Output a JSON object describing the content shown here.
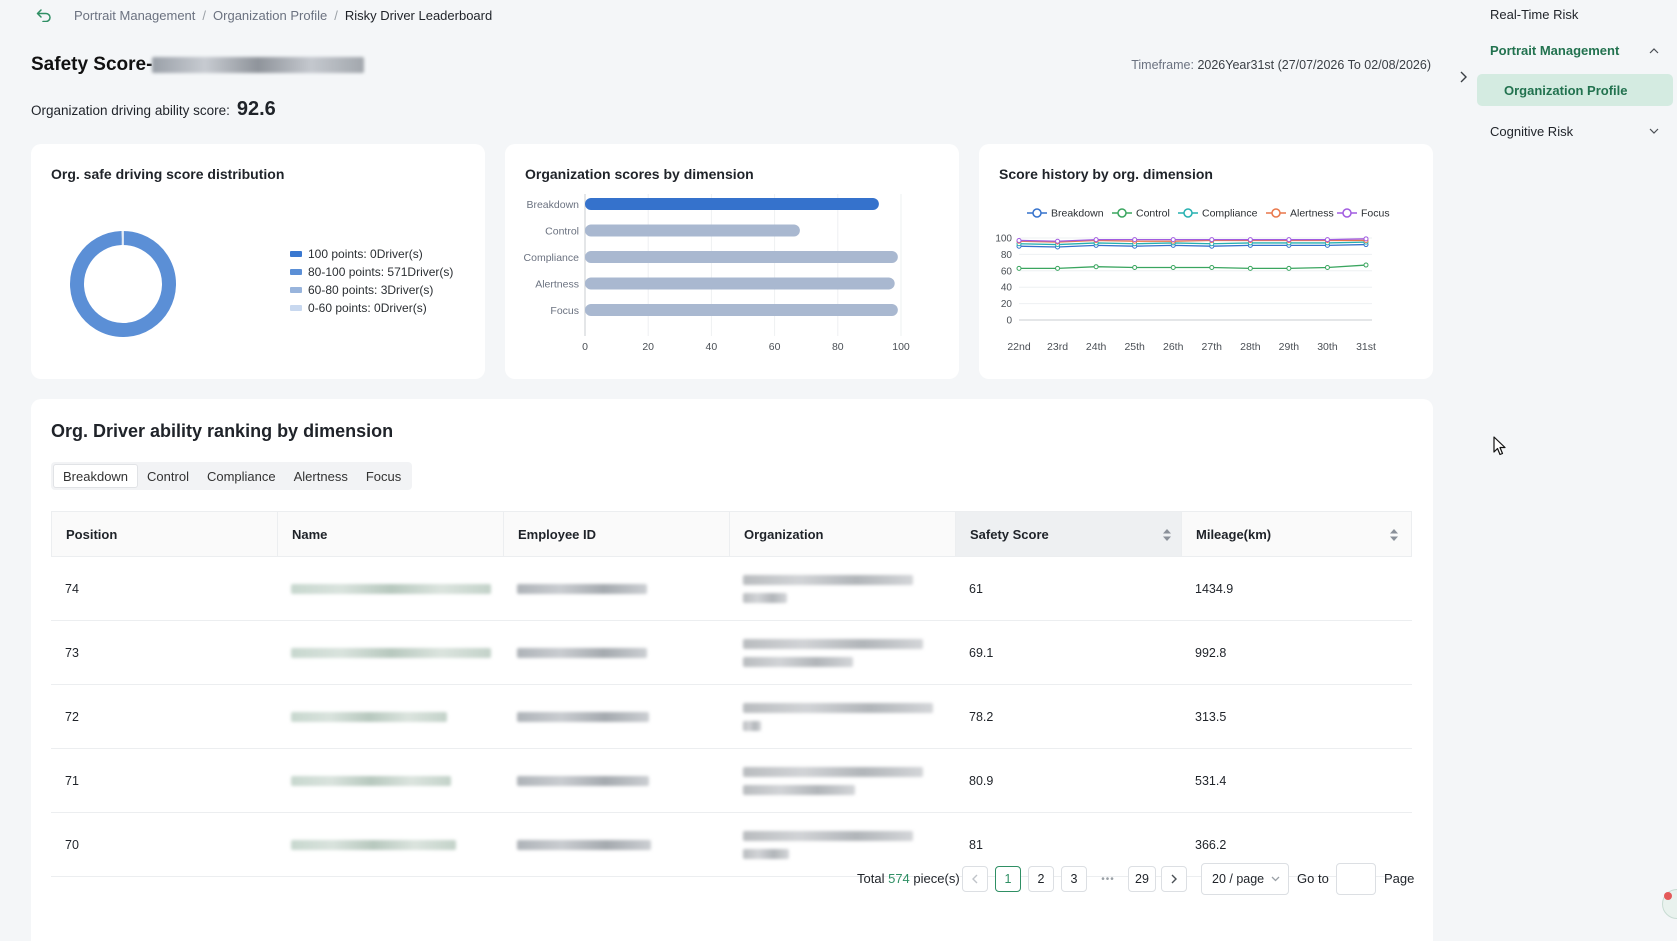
{
  "breadcrumb": {
    "items": [
      "Portrait Management",
      "Organization Profile"
    ],
    "current": "Risky Driver Leaderboard"
  },
  "header": {
    "title_prefix": "Safety Score-",
    "timeframe_label": "Timeframe:",
    "timeframe_value": "2026Year31st (27/07/2026 To 02/08/2026)",
    "ability_label": "Organization driving ability score:",
    "ability_value": "92.6"
  },
  "cards": {
    "distribution": {
      "title": "Org. safe driving score distribution",
      "legend": [
        {
          "label": "100 points:",
          "value": "0Driver(s)",
          "color": "#3a78d0"
        },
        {
          "label": "80-100 points:",
          "value": "571Driver(s)",
          "color": "#5b8fd6"
        },
        {
          "label": "60-80 points:",
          "value": "3Driver(s)",
          "color": "#98b4dc"
        },
        {
          "label": "0-60 points:",
          "value": "0Driver(s)",
          "color": "#c8d8ef"
        }
      ]
    },
    "by_dimension": {
      "title": "Organization scores by dimension"
    },
    "history": {
      "title": "Score history by org. dimension"
    }
  },
  "chart_data": [
    {
      "type": "pie",
      "categories": [
        "100 points",
        "80-100 points",
        "60-80 points",
        "0-60 points"
      ],
      "values": [
        0,
        571,
        3,
        0
      ]
    },
    {
      "type": "bar",
      "categories": [
        "Breakdown",
        "Control",
        "Compliance",
        "Alertness",
        "Focus"
      ],
      "values": [
        93,
        68,
        99,
        98,
        99
      ],
      "xlim": [
        0,
        100
      ],
      "xticks": [
        0,
        20,
        40,
        60,
        80,
        100
      ],
      "highlight_color": "#3572cc",
      "bar_color": "#a9b8d0"
    },
    {
      "type": "line",
      "x": [
        "22nd",
        "23rd",
        "24th",
        "25th",
        "26th",
        "27th",
        "28th",
        "29th",
        "30th",
        "31st"
      ],
      "ylim": [
        0,
        100
      ],
      "yticks": [
        0,
        20,
        40,
        60,
        80,
        100
      ],
      "series": [
        {
          "name": "Breakdown",
          "color": "#3572cc",
          "values": [
            90,
            89,
            91,
            90,
            91,
            90,
            91,
            91,
            91,
            92
          ]
        },
        {
          "name": "Control",
          "color": "#3aa55f",
          "values": [
            63,
            63,
            65,
            64,
            64,
            64,
            63,
            63,
            64,
            67
          ]
        },
        {
          "name": "Compliance",
          "color": "#25b0b0",
          "values": [
            93,
            92,
            94,
            93,
            94,
            93,
            94,
            94,
            94,
            95
          ]
        },
        {
          "name": "Alertness",
          "color": "#e9774a",
          "values": [
            96,
            95,
            97,
            96,
            96,
            97,
            97,
            97,
            97,
            97
          ]
        },
        {
          "name": "Focus",
          "color": "#a15be0",
          "values": [
            97,
            96,
            98,
            98,
            98,
            98,
            98,
            98,
            98,
            99
          ]
        }
      ]
    }
  ],
  "ranking": {
    "title": "Org. Driver ability ranking by dimension",
    "tabs": [
      "Breakdown",
      "Control",
      "Compliance",
      "Alertness",
      "Focus"
    ],
    "active_tab": "Breakdown",
    "columns": [
      "Position",
      "Name",
      "Employee ID",
      "Organization",
      "Safety Score",
      "Mileage(km)"
    ],
    "rows": [
      {
        "position": "74",
        "score": "61",
        "mileage": "1434.9"
      },
      {
        "position": "73",
        "score": "69.1",
        "mileage": "992.8"
      },
      {
        "position": "72",
        "score": "78.2",
        "mileage": "313.5"
      },
      {
        "position": "71",
        "score": "80.9",
        "mileage": "531.4"
      },
      {
        "position": "70",
        "score": "81",
        "mileage": "366.2"
      }
    ]
  },
  "pagination": {
    "total_prefix": "Total",
    "total": "574",
    "total_suffix": "piece(s)",
    "pages": [
      "1",
      "2",
      "3"
    ],
    "ellipsis": "•••",
    "last_page": "29",
    "current_page": "1",
    "page_size": "20 / page",
    "goto_label": "Go to",
    "page_label": "Page"
  },
  "sidebar": {
    "items": [
      "Real-Time Risk",
      "Portrait Management",
      "Organization Profile",
      "Cognitive Risk"
    ],
    "active": "Organization Profile",
    "accent": "#22724f"
  }
}
